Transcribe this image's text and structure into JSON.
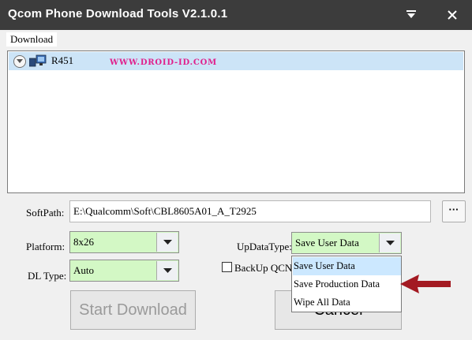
{
  "window": {
    "title": "Qcom Phone Download Tools V2.1.0.1",
    "minimize_icon": "minimize-arrow-icon",
    "close_icon": "close-icon"
  },
  "menu": {
    "items": [
      {
        "label": "Download"
      }
    ]
  },
  "device_list": {
    "items": [
      {
        "name": "R451",
        "icon": "computer-device-icon",
        "expander": "chevron-down-icon"
      }
    ]
  },
  "watermark": "WWW.DROID-ID.COM",
  "soft_path": {
    "label": "SoftPath:",
    "value": "E:\\Qualcomm\\Soft\\CBL8605A01_A_T2925",
    "browse_label": "···"
  },
  "platform": {
    "label": "Platform:",
    "value": "8x26"
  },
  "dl_type": {
    "label": "DL Type:",
    "value": "Auto"
  },
  "up_data_type": {
    "label": "UpDataType:",
    "value": "Save User Data",
    "options": [
      "Save User Data",
      "Save Production Data",
      "Wipe All Data"
    ],
    "highlighted_index": 0
  },
  "backup_qcn": {
    "label": "BackUp QCN",
    "checked": false
  },
  "buttons": {
    "start": "Start Download",
    "cancel": "Cancel"
  },
  "colors": {
    "titlebar": "#3c3c3c",
    "combo_bg": "#d3f8c5",
    "selected_row": "#cce4f7",
    "annotation_arrow": "#a31a22",
    "watermark": "#e0208c"
  }
}
